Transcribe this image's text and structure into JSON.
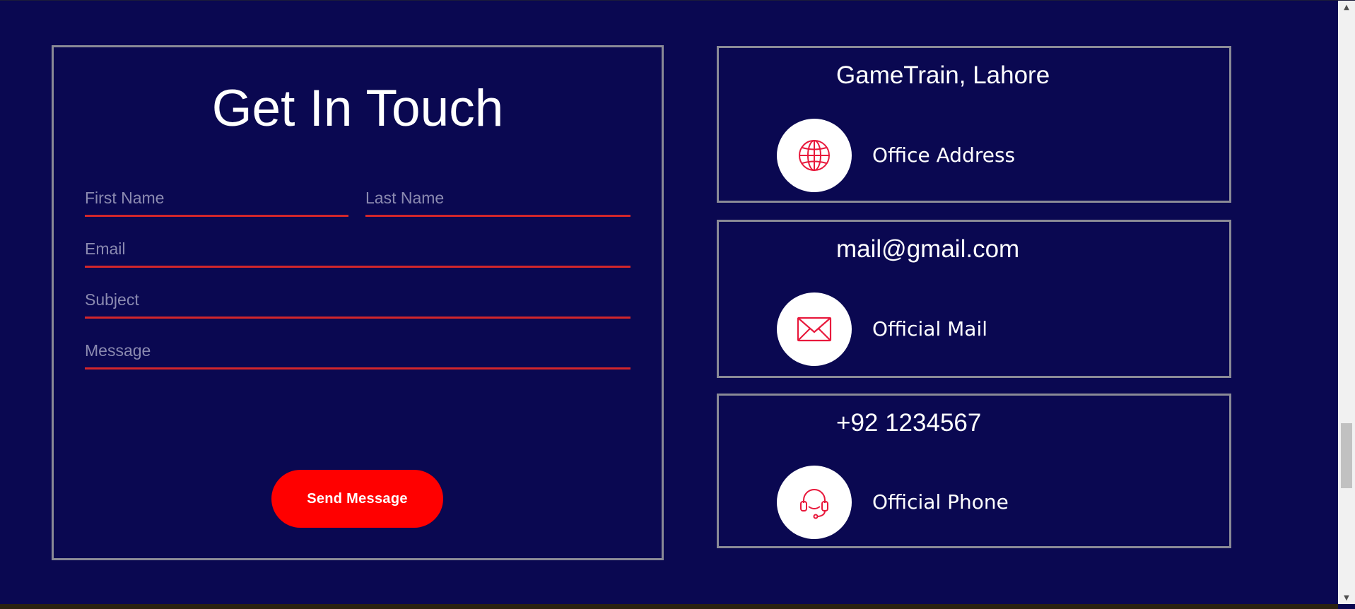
{
  "contact_form": {
    "title": "Get In Touch",
    "fields": {
      "first_name": {
        "placeholder": "First Name",
        "value": ""
      },
      "last_name": {
        "placeholder": "Last Name",
        "value": ""
      },
      "email": {
        "placeholder": "Email",
        "value": ""
      },
      "subject": {
        "placeholder": "Subject",
        "value": ""
      },
      "message": {
        "placeholder": "Message",
        "value": ""
      }
    },
    "submit_label": "Send Message"
  },
  "contact_info": [
    {
      "heading": "GameTrain, Lahore",
      "label": "Office Address",
      "icon": "globe-icon"
    },
    {
      "heading": "mail@gmail.com",
      "label": "Official Mail",
      "icon": "mail-icon"
    },
    {
      "heading": "+92 1234567",
      "label": "Official Phone",
      "icon": "headset-icon"
    }
  ],
  "colors": {
    "background": "#0a0851",
    "accent": "#ff0000",
    "field_underline": "#d2262b",
    "icon": "#e8193c",
    "card_border": "#8a8a96"
  }
}
